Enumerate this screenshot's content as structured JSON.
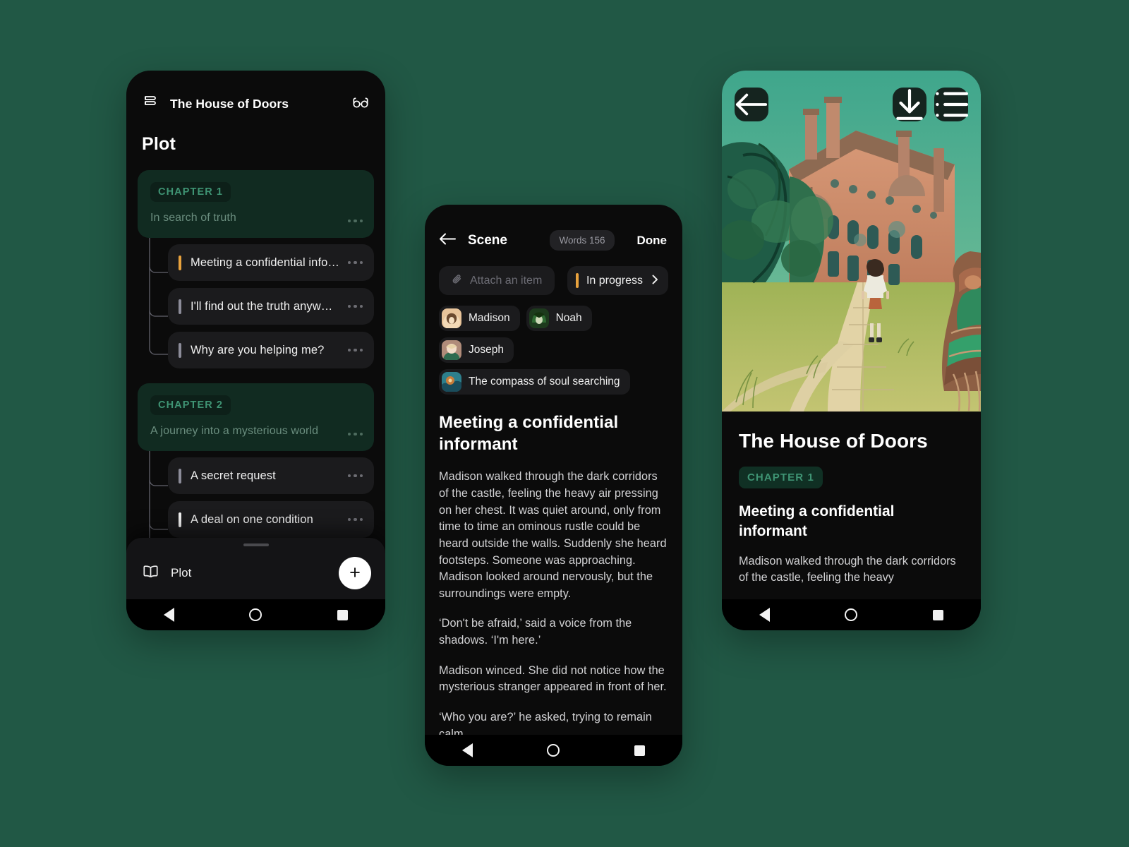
{
  "theme": {
    "background": "#215845",
    "phone_bg": "#0b0b0b",
    "card_bg": "#1b1b1d",
    "chapter_card_bg": "#112b21",
    "chapter_text": "#3f9474",
    "accent_orange": "#e8a23d",
    "accent_grey": "#8c8c99",
    "text_primary": "#ffffff",
    "text_body": "#d2d2d4"
  },
  "plot_screen": {
    "header": {
      "book_icon": "books-icon",
      "title": "The House of Doors",
      "reader_icon": "reading-glasses-icon"
    },
    "section_title": "Plot",
    "chapters": [
      {
        "badge": "CHAPTER 1",
        "subtitle": "In search of truth",
        "menu": "more-options",
        "scenes": [
          {
            "title": "Meeting a confidential info…",
            "accent": "orange"
          },
          {
            "title": "I'll find out the truth anyw…",
            "accent": "grey"
          },
          {
            "title": "Why are you helping me?",
            "accent": "grey"
          }
        ]
      },
      {
        "badge": "CHAPTER 2",
        "subtitle": "A journey into a mysterious world",
        "menu": "more-options",
        "scenes": [
          {
            "title": "A secret request",
            "accent": "grey"
          },
          {
            "title": "A deal on one condition",
            "accent": "white"
          }
        ]
      }
    ],
    "bottom_sheet": {
      "icon": "open-book-icon",
      "label": "Plot",
      "add_label": "+"
    },
    "nav": {
      "back": "back-icon",
      "home": "home-icon",
      "recent": "recent-apps-icon"
    }
  },
  "scene_screen": {
    "header": {
      "back_icon": "back-arrow-icon",
      "title": "Scene",
      "words_pill": "Words 156",
      "done_label": "Done"
    },
    "attach": {
      "icon": "paperclip-icon",
      "placeholder": "Attach an item"
    },
    "status": {
      "label": "In progress",
      "accent": "orange",
      "chevron": "chevron-right-icon"
    },
    "tags": [
      {
        "label": "Madison",
        "avatar": "avatar-madison"
      },
      {
        "label": "Noah",
        "avatar": "avatar-noah"
      },
      {
        "label": "Joseph",
        "avatar": "avatar-joseph"
      },
      {
        "label": "The compass of soul searching",
        "avatar": "avatar-compass"
      }
    ],
    "scene_title": "Meeting a confidential informant",
    "paragraphs": [
      "Madison walked through the dark corridors of the castle, feeling the heavy air pressing on her chest. It was quiet around, only from time to time an ominous rustle could be heard outside the walls. Suddenly she heard footsteps. Someone was approaching. Madison looked around nervously, but the surroundings were empty.",
      "‘Don't be afraid,’ said a voice from the shadows. ‘I'm here.’",
      "Madison winced. She did not notice how the mysterious stranger appeared in front of her.",
      "‘Who you are?’ he asked, trying to remain calm."
    ],
    "nav": {
      "back": "back-icon",
      "home": "home-icon",
      "recent": "recent-apps-icon"
    }
  },
  "reader_screen": {
    "cover": {
      "alt": "illustrated-mansion-cover",
      "back_icon": "back-arrow-icon",
      "download_icon": "download-icon",
      "contents_icon": "table-of-contents-icon"
    },
    "book_title": "The House of Doors",
    "chapter_badge": "CHAPTER 1",
    "scene_title": "Meeting a confidential informant",
    "excerpt": "Madison walked through the dark corridors of the castle, feeling the heavy",
    "nav": {
      "back": "back-icon",
      "home": "home-icon",
      "recent": "recent-apps-icon"
    }
  }
}
